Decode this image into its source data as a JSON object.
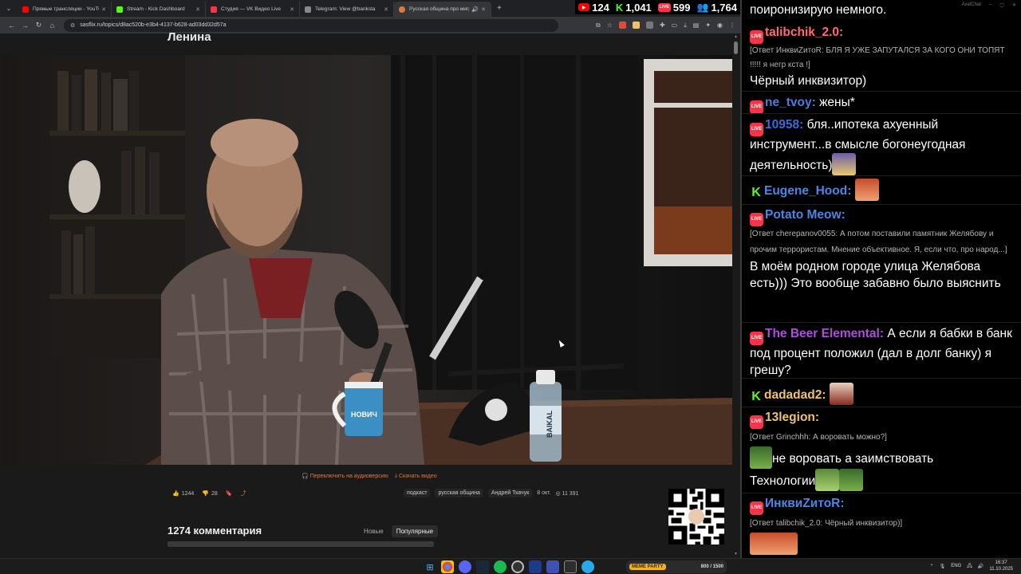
{
  "browser": {
    "tabs": [
      {
        "label": "Прямые трансляции - YouTube",
        "color": "#ff0000"
      },
      {
        "label": "Stream - Kick Dashboard",
        "color": "#53fc18"
      },
      {
        "label": "Студия — VK Видео Live",
        "color": "#ff3347"
      },
      {
        "label": "Telegram: View @banksta",
        "color": "#888888"
      },
      {
        "label": "Русская община про миграции",
        "color": "#e07a3a"
      }
    ],
    "new_tab": "+",
    "url": "sasflix.ru/topics/d8ac520b-e3b4-4137-b628-ad03dd32d57a"
  },
  "counters": [
    {
      "platform": "youtube",
      "value": "124"
    },
    {
      "platform": "kick",
      "value": "1,041"
    },
    {
      "platform": "vk",
      "value": "599"
    },
    {
      "platform": "twitch",
      "value": "1,764"
    }
  ],
  "page": {
    "title_fragment": "Ленина",
    "switch_audio": "Переключить на аудиоверсию",
    "download": "Скачать видео",
    "likes": "1244",
    "dislikes": "28",
    "tags": [
      "подкаст",
      "русская община",
      "Андрей Ткачук"
    ],
    "date": "8 окт.",
    "views": "11 391",
    "comments_title": "1274 комментария",
    "sort_new": "Новые",
    "sort_popular": "Популярные"
  },
  "chat": {
    "window_title": "AxelChat",
    "top_fragment": "поиронизирую немного.",
    "messages": [
      {
        "platform": "vk",
        "name": "talibchik_2.0:",
        "name_color": "#ff6b6b",
        "reply": "[Ответ ИнквиZитоR: БЛЯ Я УЖЕ ЗАПУТАЛСЯ ЗА КОГО ОНИ ТОПЯТ !!!!! я негр кста !]",
        "text": "Чёрный инквизитор)"
      },
      {
        "platform": "vk",
        "name": "ne_tvoy:",
        "name_color": "#4f7bdc",
        "text": "жены*"
      },
      {
        "platform": "vk",
        "name": "10958:",
        "name_color": "#3a6bd8",
        "text": "бля..ипотека ахуенный инструмент...в смысле богонеугодная деятельность)"
      },
      {
        "platform": "kick",
        "name": "Eugene_Hood:",
        "name_color": "#4a86e8",
        "text": ""
      },
      {
        "platform": "vk",
        "name": "Potato Meow:",
        "name_color": "#4a86e8",
        "reply": "[Ответ cherepanov0055: А потом поставили памятник Желябову и прочим террористам. Мнение объективное. Я, если что, про народ...]",
        "text": "В моём родном городе улица Желябова есть))) Это вообще забавно было выяснить"
      },
      {
        "platform": "vk",
        "name": "The Beer Elemental:",
        "name_color": "#b14dde",
        "text": "А если я бабки в банк под процент положил (дал в долг банку) я грешу?"
      },
      {
        "platform": "kick",
        "name": "dadadad2:",
        "name_color": "#f0c36a",
        "text": ""
      },
      {
        "platform": "vk",
        "name": "13legion:",
        "name_color": "#f0c36a",
        "reply": "[Ответ Grinchhh: А воровать можно?]",
        "text_a": "не воровать а заимствовать",
        "text_b": "Технологии"
      },
      {
        "platform": "vk",
        "name": "ИнквиZитоR:",
        "name_color": "#4a86e8",
        "reply": "[Ответ talibchik_2.0: Чёрный инквизитор)]",
        "text": ""
      }
    ]
  },
  "taskbar": {
    "widget_label": "MEME PARTY",
    "widget_count": "800 / 1500",
    "lang": "ENG",
    "time": "16:37",
    "date": "11.10.2025"
  }
}
